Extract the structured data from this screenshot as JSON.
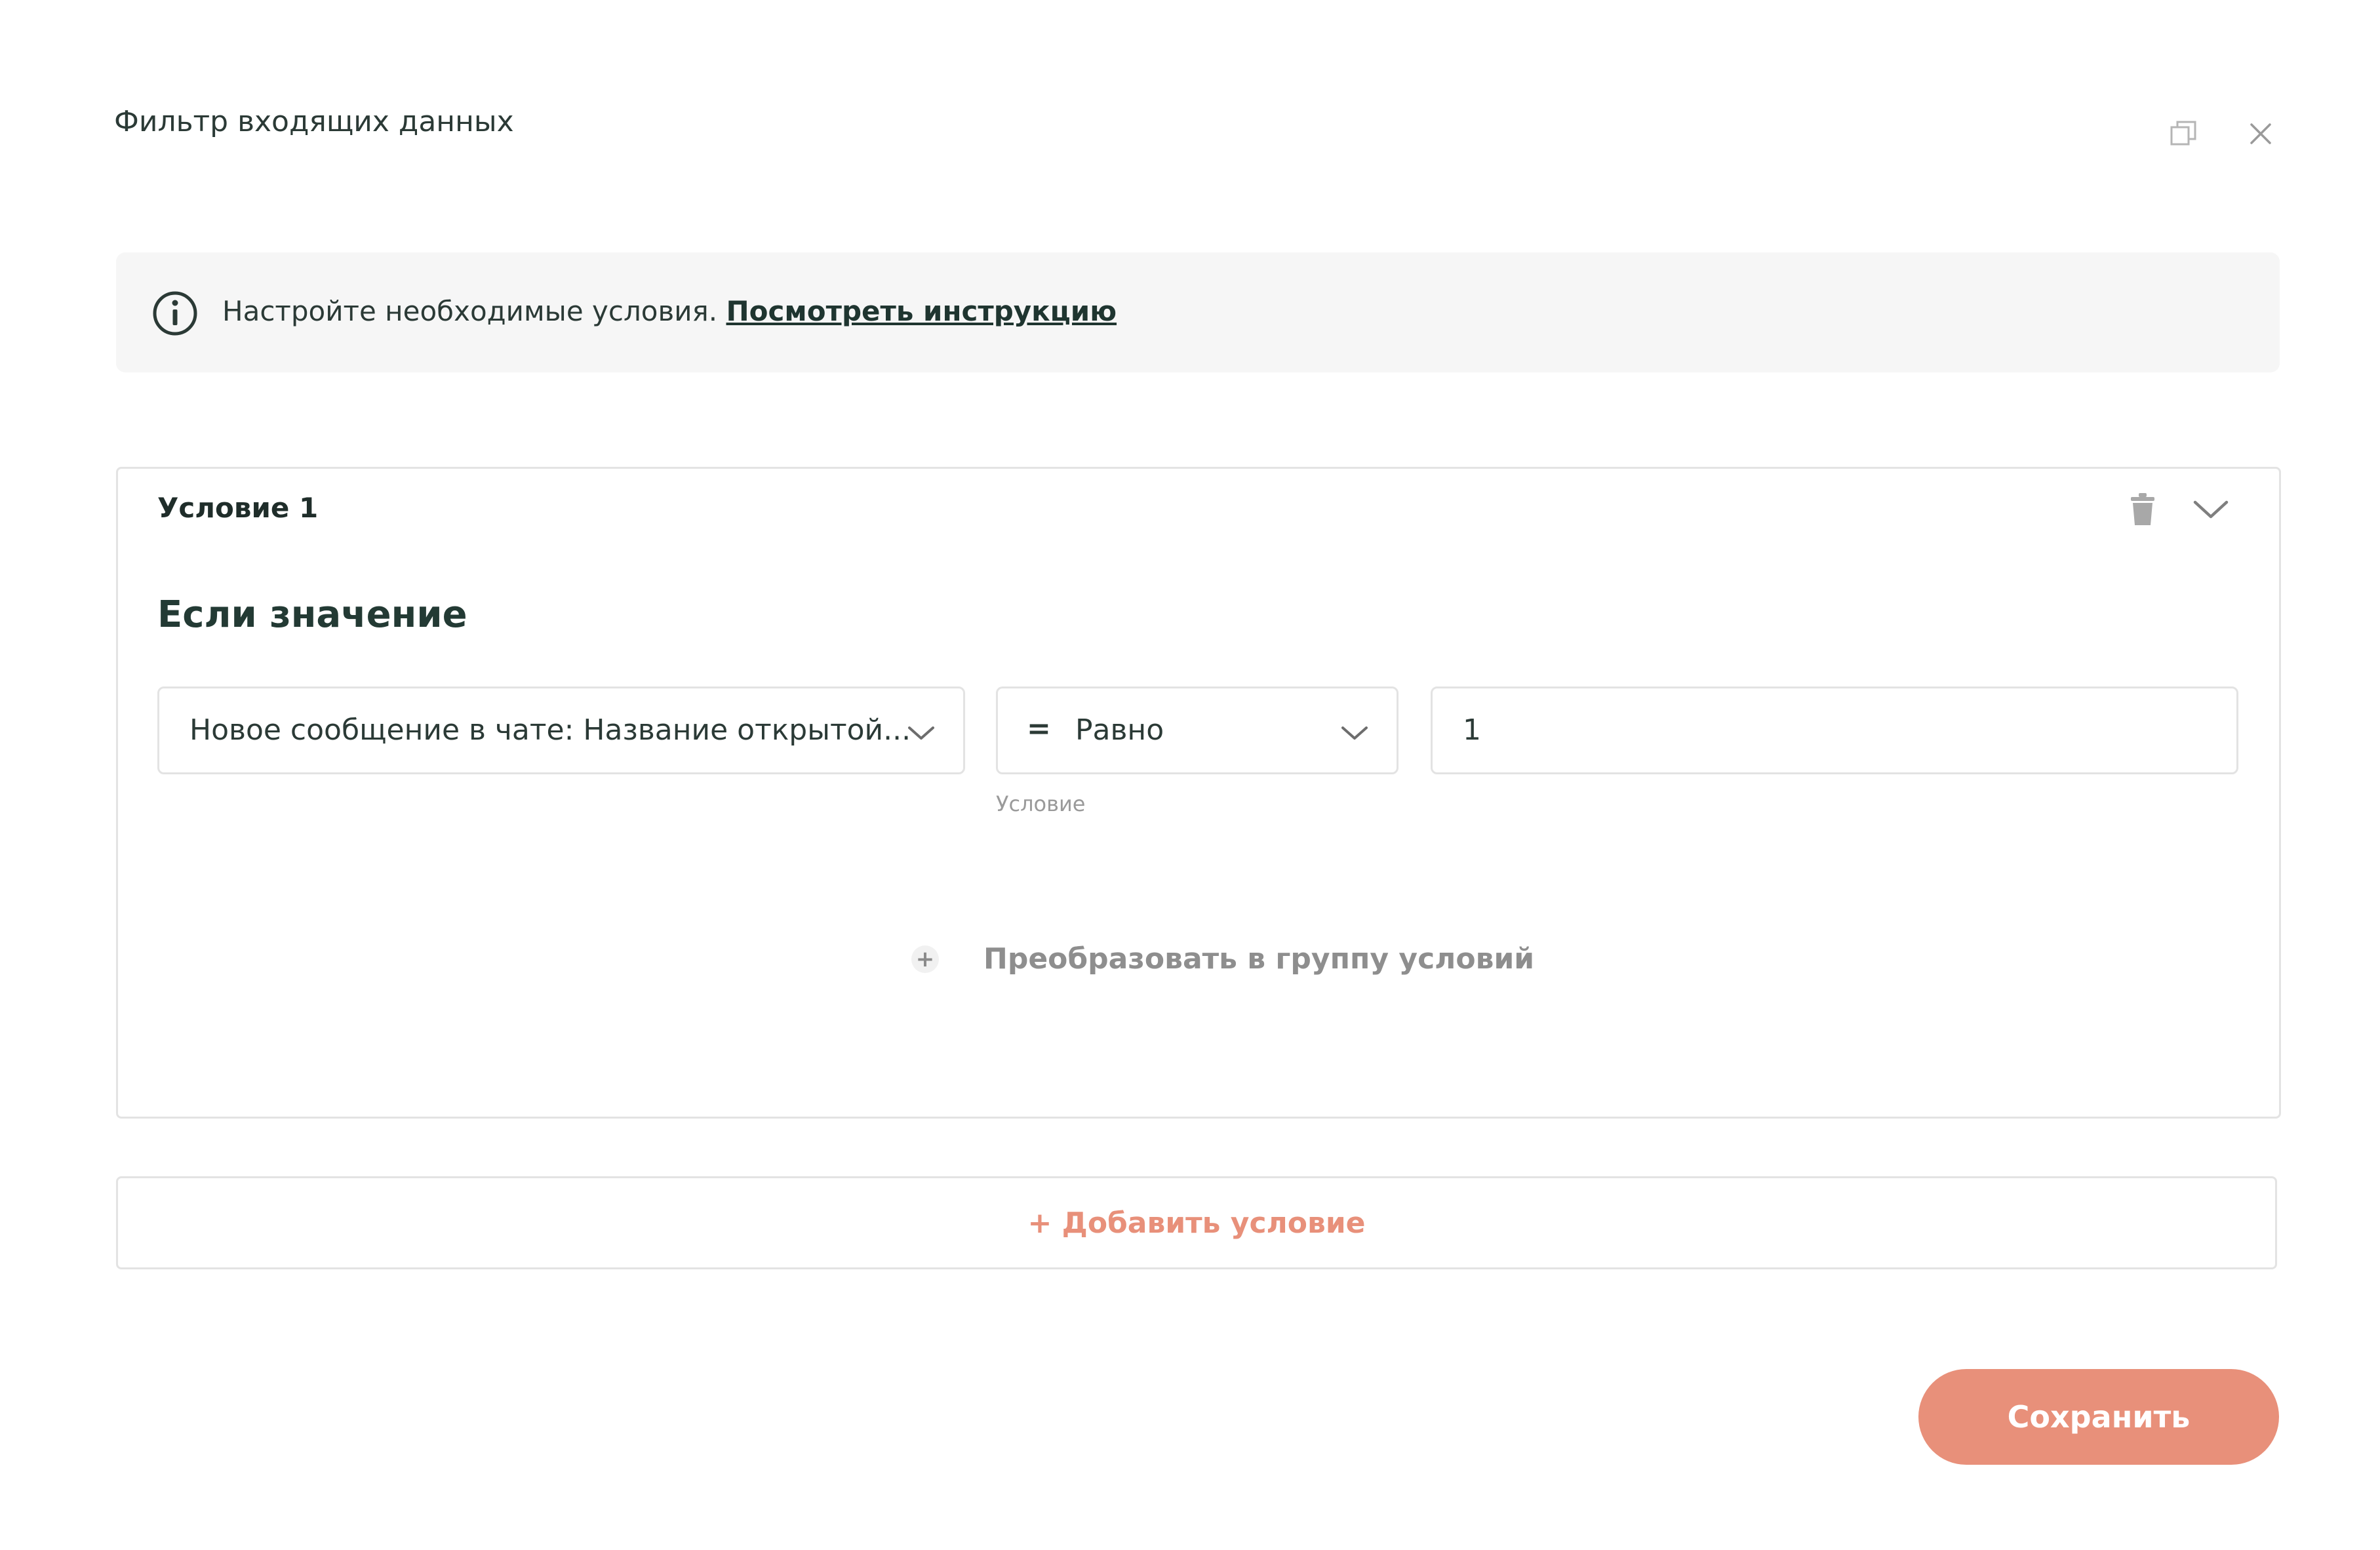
{
  "dialog": {
    "title": "Фильтр входящих данных",
    "copy_icon": "copy-window-icon",
    "close_icon": "close-icon"
  },
  "info_banner": {
    "icon": "info-icon",
    "text": "Настройте необходимые условия. ",
    "link_label": "Посмотреть инструкцию"
  },
  "condition": {
    "title": "Условие 1",
    "delete_icon": "trash-icon",
    "collapse_icon": "chevron-down-icon",
    "if_heading": "Если значение",
    "field_select": {
      "value": "Новое сообщение в чате: Название открытой..."
    },
    "operator_select": {
      "symbol": "=",
      "value": "Равно",
      "caption": "Условие"
    },
    "value_input": {
      "value": "1"
    },
    "convert_group_label": "Преобразовать в группу условий",
    "convert_icon": "plus-icon"
  },
  "add_condition_label": "+ Добавить условие",
  "save_label": "Сохранить",
  "colors": {
    "accent": "#e8907a",
    "text_dark": "#2b3a36",
    "border": "#e3e3e3",
    "banner_bg": "#f6f6f6",
    "muted": "#8e8e8e"
  }
}
